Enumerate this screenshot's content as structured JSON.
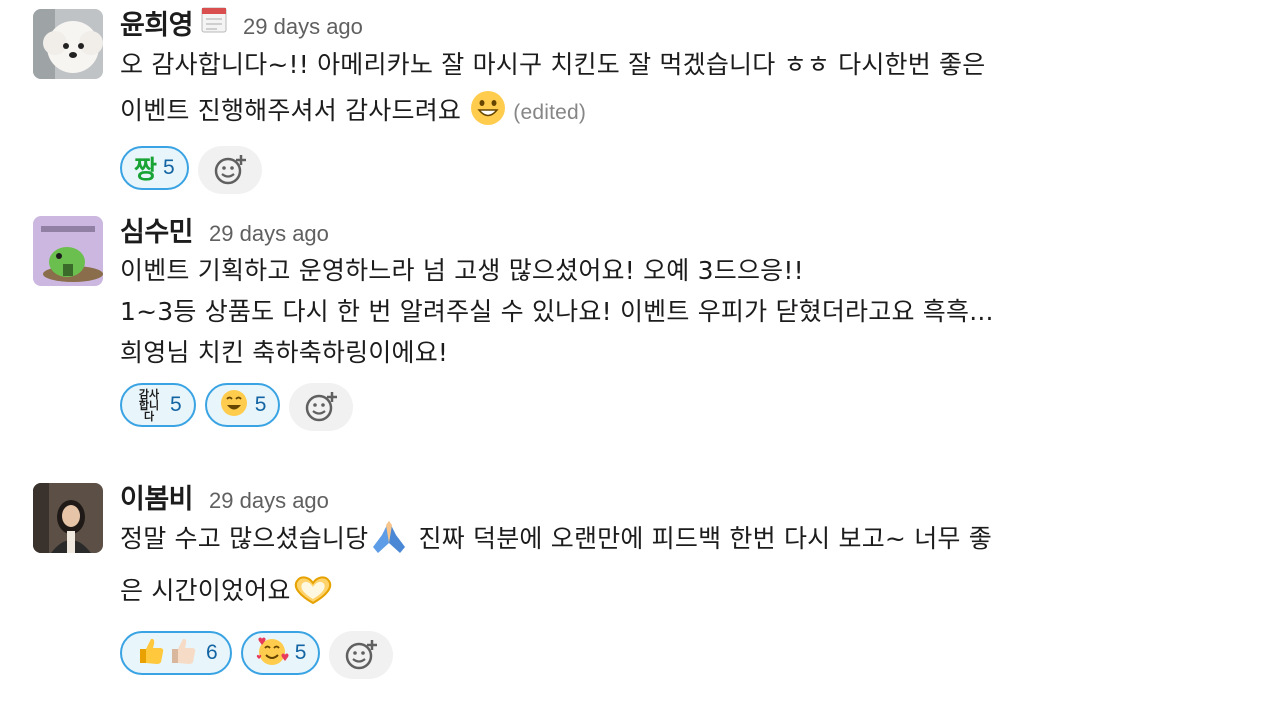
{
  "messages": [
    {
      "author": "윤희영",
      "timestamp": "29 days ago",
      "status_icon": "calendar-icon",
      "text": "오 감사합니다~!! 아메리카노 잘 마시구 치킨도 잘 먹겠습니다 ㅎㅎ 다시한번 좋은\n이벤트 진행해주셔서 감사드려요",
      "inline_emoji": "grinning-face-icon",
      "edited_label": "(edited)",
      "reactions": [
        {
          "emoji": "짱",
          "count": "5"
        }
      ]
    },
    {
      "author": "심수민",
      "timestamp": "29 days ago",
      "text": "이벤트 기획하고 운영하느라 넘 고생 많으셨어요! 오예 3드으응!!\n1~3등 상품도 다시 한 번 알려주실 수 있나요! 이벤트 우피가 닫혔더라고요 흑흑...\n희영님 치킨 축하축하링이에요!",
      "reactions": [
        {
          "emoji": "감사\n합니다",
          "count": "5"
        },
        {
          "emoji": "smiling-face-icon",
          "count": "5"
        }
      ]
    },
    {
      "author": "이봄비",
      "timestamp": "29 days ago",
      "text_line1": "정말 수고 많으셨습니당",
      "text_line1b": " 진짜 덕분에 오랜만에 피드백 한번 다시 보고~ 너무 좋",
      "text_line2": "은 시간이었어요",
      "inline_emojis": [
        "folded-hands-icon",
        "heart-hands-icon"
      ],
      "reactions": [
        {
          "emoji": "thumbs-up-icon",
          "count": "6"
        },
        {
          "emoji": "smiling-face-with-hearts-icon",
          "count": "5"
        }
      ]
    }
  ],
  "add_reaction_icon": "add-reaction-icon",
  "colors": {
    "reaction_border": "#3aa3e3",
    "reaction_bg": "#e8f5fa",
    "reaction_count": "#1264a3",
    "timestamp": "#616061"
  }
}
